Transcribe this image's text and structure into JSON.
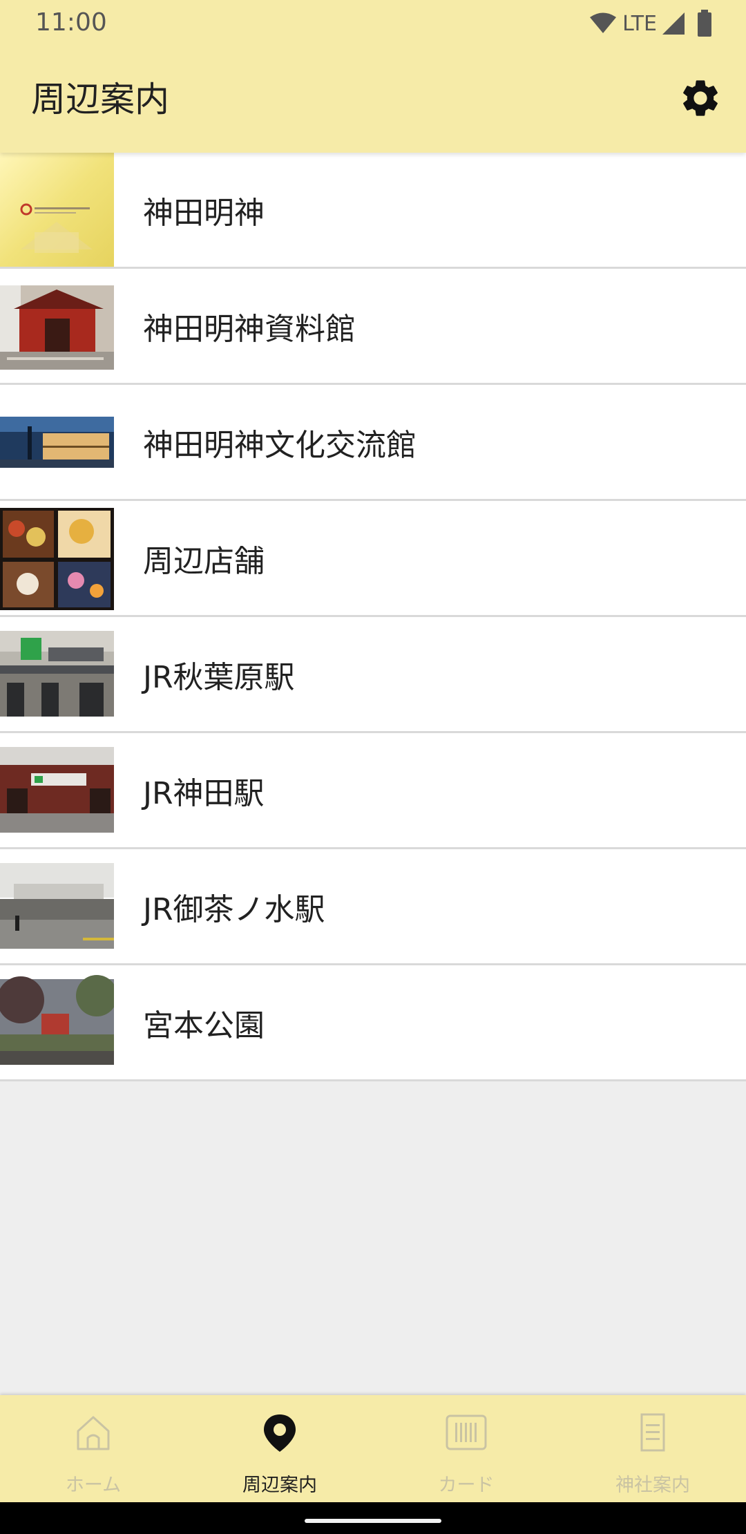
{
  "status": {
    "time": "11:00",
    "network": "LTE",
    "icons": [
      "wifi-icon",
      "cell-signal-icon",
      "battery-icon"
    ]
  },
  "appbar": {
    "title": "周辺案内",
    "settings_icon": "gear-icon"
  },
  "places": [
    {
      "label": "神田明神"
    },
    {
      "label": "神田明神資料館"
    },
    {
      "label": "神田明神文化交流館"
    },
    {
      "label": "周辺店舗"
    },
    {
      "label": "JR秋葉原駅"
    },
    {
      "label": "JR神田駅"
    },
    {
      "label": "JR御茶ノ水駅"
    },
    {
      "label": "宮本公園"
    }
  ],
  "nav": {
    "items": [
      {
        "label": "ホーム",
        "icon": "home-icon"
      },
      {
        "label": "周辺案内",
        "icon": "location-pin-icon"
      },
      {
        "label": "カード",
        "icon": "barcode-card-icon"
      },
      {
        "label": "神社案内",
        "icon": "document-icon"
      }
    ],
    "active_index": 1
  },
  "colors": {
    "bar_background": "#F6EBA8",
    "list_background": "#FFFFFF",
    "page_background": "#EEEEEE",
    "active_nav": "#1E1E1E",
    "inactive_nav": "#C9C3A3"
  }
}
